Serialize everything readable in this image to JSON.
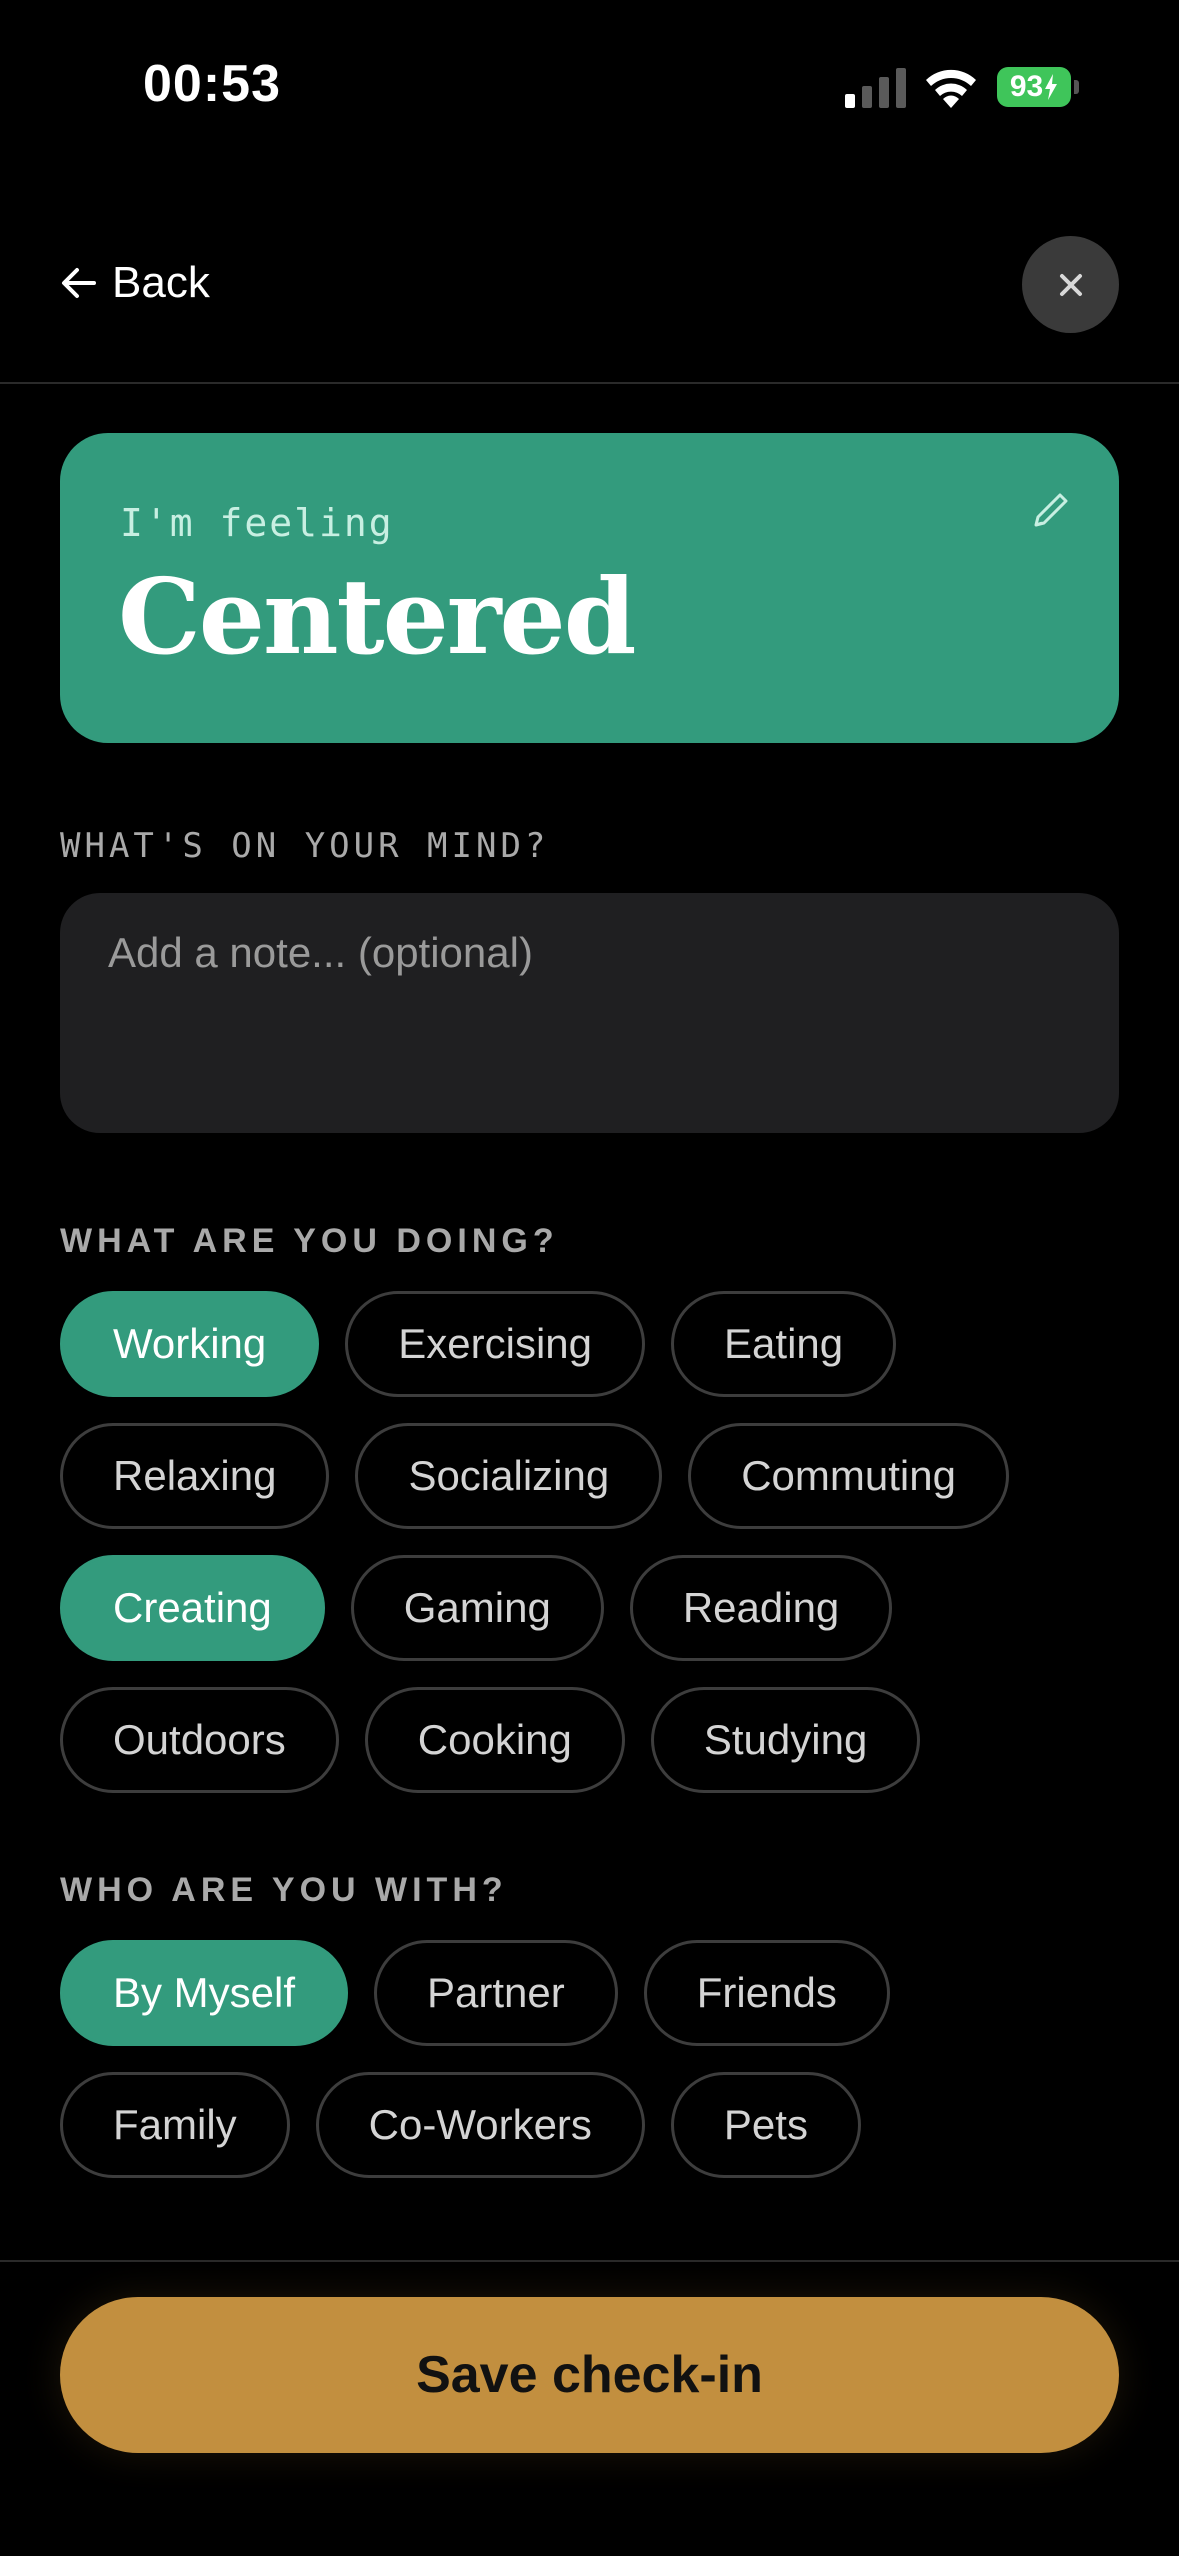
{
  "status_bar": {
    "time": "00:53",
    "battery": "93",
    "icons": [
      "signal-icon",
      "wifi-icon",
      "battery-charging-icon"
    ]
  },
  "header": {
    "back_label": "Back",
    "back_icon": "arrow-left-icon",
    "close_icon": "close-icon"
  },
  "feeling": {
    "prefix": "I'm feeling",
    "value": "Centered",
    "edit_icon": "pencil-icon",
    "color": "#339b7d"
  },
  "note": {
    "label": "WHAT'S ON YOUR MIND?",
    "placeholder": "Add a note... (optional)",
    "value": ""
  },
  "activities": {
    "label": "WHAT ARE YOU DOING?",
    "rows": [
      [
        {
          "label": "Working",
          "selected": true
        },
        {
          "label": "Exercising",
          "selected": false
        },
        {
          "label": "Eating",
          "selected": false
        }
      ],
      [
        {
          "label": "Relaxing",
          "selected": false
        },
        {
          "label": "Socializing",
          "selected": false
        },
        {
          "label": "Commuting",
          "selected": false
        }
      ],
      [
        {
          "label": "Creating",
          "selected": true
        },
        {
          "label": "Gaming",
          "selected": false
        },
        {
          "label": "Reading",
          "selected": false
        }
      ],
      [
        {
          "label": "Outdoors",
          "selected": false
        },
        {
          "label": "Cooking",
          "selected": false
        },
        {
          "label": "Studying",
          "selected": false
        }
      ]
    ]
  },
  "companions": {
    "label": "WHO ARE YOU WITH?",
    "rows": [
      [
        {
          "label": "By Myself",
          "selected": true
        },
        {
          "label": "Partner",
          "selected": false
        },
        {
          "label": "Friends",
          "selected": false
        }
      ],
      [
        {
          "label": "Family",
          "selected": false
        },
        {
          "label": "Co-Workers",
          "selected": false
        },
        {
          "label": "Pets",
          "selected": false
        }
      ]
    ]
  },
  "save_button": {
    "label": "Save check-in",
    "color": "#c28f3f"
  },
  "colors": {
    "background": "#000000",
    "accent": "#339b7d",
    "chip_border": "#3d3d3d",
    "save": "#c28f3f"
  }
}
